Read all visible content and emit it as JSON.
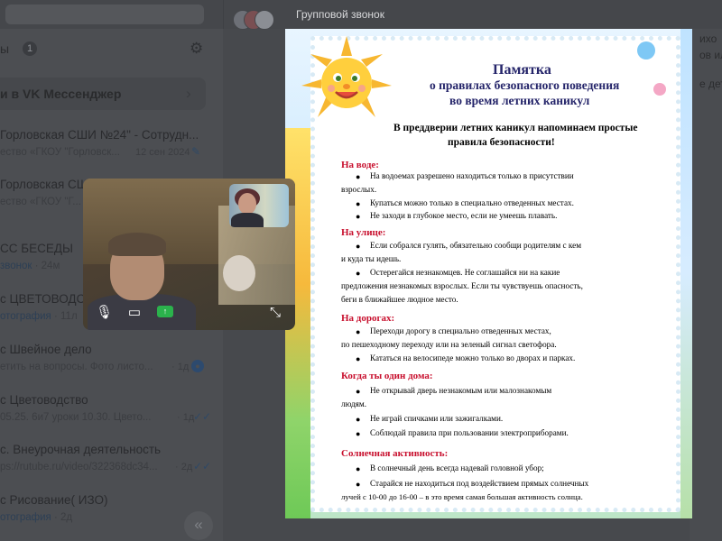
{
  "sidebar": {
    "header_title": "ы",
    "header_badge": "1",
    "promo_title": "и в VK Мессенджер",
    "chats": [
      {
        "title": "Горловская СШИ №24\" - Сотрудн...",
        "sub": "ество «ГКОУ \"Горловск...",
        "time": "12 сен 2024",
        "mark": "pin"
      },
      {
        "title": "Горловская СШИ",
        "sub": "ество «ГКОУ \"Г...",
        "time": "",
        "mark": ""
      },
      {
        "title": "СС БЕСЕДЫ",
        "sub": "звонок",
        "sub_time": "· 24м",
        "time": "",
        "mark": ""
      },
      {
        "title": "с ЦВЕТОВОДСТ...",
        "sub": "отография",
        "sub_time": "· 11л",
        "time": "",
        "mark": ""
      },
      {
        "title": "с Швейное дело",
        "sub": "етить на вопросы. Фото листо...",
        "time": "· 1д",
        "mark": "unread"
      },
      {
        "title": "с Цветоводство",
        "sub": "05.25. 6и7 уроки 10.30. Цвето...",
        "time": "· 1д",
        "mark": "read"
      },
      {
        "title": "с. Внеурочная деятельность",
        "sub": "ps://rutube.ru/video/322368dc34...",
        "time": "· 2д",
        "mark": "read"
      },
      {
        "title": "с Рисование( ИЗО)",
        "sub": "отография",
        "time": "· 2д",
        "mark": ""
      }
    ]
  },
  "chatpane": {
    "call_title": "Групповой звонок",
    "right_texts": [
      "ихо",
      "ов ил",
      "е дет"
    ]
  },
  "poster": {
    "title_main": "Памятка",
    "title_line2": "о правилах безопасного поведения",
    "title_line3": "во время летних каникул",
    "intro_line1": "В преддверии летних каникул напоминаем простые",
    "intro_line2": "правила безопасности!",
    "sections": [
      {
        "heading": "На воде:",
        "lines": [
          {
            "text": "На водоемах разрешено находиться только в присутствии",
            "bullet": true
          },
          {
            "text": "взрослых.",
            "bullet": false
          },
          {
            "text": "Купаться можно только в специально отведенных местах.",
            "bullet": true
          },
          {
            "text": "Не заходи в глубокое место, если не умеешь плавать.",
            "bullet": true
          }
        ]
      },
      {
        "heading": "На улице:",
        "lines": [
          {
            "text": "Если собрался гулять, обязательно сообщи родителям с кем",
            "bullet": true
          },
          {
            "text": "и куда ты идешь.",
            "bullet": false
          },
          {
            "text": "Остерегайся незнакомцев. Не соглашайся ни на какие",
            "bullet": true
          },
          {
            "text": "предложения незнакомых взрослых. Если ты чувствуешь опасность,",
            "bullet": false
          },
          {
            "text": "беги в ближайшее людное место.",
            "bullet": false
          }
        ]
      },
      {
        "heading": "На дорогах:",
        "lines": [
          {
            "text": "Переходи дорогу в специально отведенных местах,",
            "bullet": true
          },
          {
            "text": "по пешеходному переходу или на зеленый сигнал светофора.",
            "bullet": false
          },
          {
            "text": "Кататься на велосипеде можно только во дворах и парках.",
            "bullet": true
          }
        ]
      },
      {
        "heading": "Когда ты один дома:",
        "lines": [
          {
            "text": "Не открывай дверь незнакомым или малознакомым",
            "bullet": true
          },
          {
            "text": "людям.",
            "bullet": false
          },
          {
            "text": "Не играй спичками или зажигалками.",
            "bullet": true
          },
          {
            "text": "Соблюдай правила при пользовании электроприборами.",
            "bullet": true
          }
        ]
      },
      {
        "heading": "Солнечная активность:",
        "lines": [
          {
            "text": "В солнечный день всегда надевай головной убор;",
            "bullet": true
          },
          {
            "text": "Старайся не находиться под воздействием прямых солнечных",
            "bullet": true
          },
          {
            "text": "лучей с 10-00 до 16-00 – в это время самая большая активность солнца.",
            "bullet": false
          }
        ]
      }
    ]
  },
  "video": {
    "controls": [
      "microphone-icon",
      "camera-icon",
      "screen-share-icon",
      "exit-fullscreen-icon"
    ]
  },
  "colors": {
    "sidebar_bg": "#4c4e52",
    "poster_heading": "#c8102e",
    "poster_title": "#25256a",
    "screen_share": "#2bb24c"
  }
}
